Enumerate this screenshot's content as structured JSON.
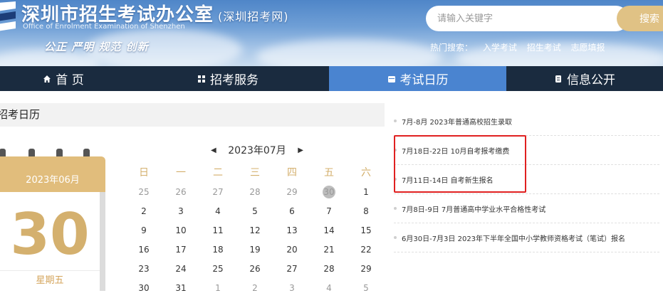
{
  "header": {
    "site_title": "深圳市招生考试办公室",
    "site_subtitle": "(深圳招考网)",
    "site_english": "Office of Enrolment Examination of Shenzhen",
    "slogan": "公正 严明 规范 创新",
    "search_placeholder": "请输入关键字",
    "search_button": "搜索",
    "hot_label": "热门搜索：",
    "hot_links": [
      "入学考试",
      "招生考试",
      "志愿填报"
    ]
  },
  "nav": {
    "items": [
      {
        "label": "首 页",
        "icon": "home-icon"
      },
      {
        "label": "招考服务",
        "icon": "grid-icon"
      },
      {
        "label": "考试日历",
        "icon": "calendar-icon",
        "active": true
      },
      {
        "label": "信息公开",
        "icon": "document-icon"
      }
    ]
  },
  "calendar_panel": {
    "title": "招考日历",
    "card": {
      "month": "2023年06月",
      "day": "30",
      "weekday": "星期五"
    },
    "month_label": "2023年07月",
    "weekdays": [
      "日",
      "一",
      "二",
      "三",
      "四",
      "五",
      "六"
    ],
    "rows": [
      [
        "25",
        "26",
        "27",
        "28",
        "29",
        "30",
        "1"
      ],
      [
        "2",
        "3",
        "4",
        "5",
        "6",
        "7",
        "8"
      ],
      [
        "9",
        "10",
        "11",
        "12",
        "13",
        "14",
        "15"
      ],
      [
        "16",
        "17",
        "18",
        "19",
        "20",
        "21",
        "22"
      ],
      [
        "23",
        "24",
        "25",
        "26",
        "27",
        "28",
        "29"
      ],
      [
        "30",
        "31",
        "1",
        "2",
        "3",
        "4",
        "5"
      ]
    ]
  },
  "news": {
    "items": [
      "7月-8月 2023年普通高校招生录取",
      "7月18日-22日 10月自考报考缴费",
      "7月11日-14日 自考新生报名",
      "7月8日-9日 7月普通高中学业水平合格性考试",
      "6月30日-7月3日 2023年下半年全国中小学教师资格考试（笔试）报名"
    ]
  },
  "colors": {
    "nav_bg": "#1a2b3f",
    "nav_active": "#4a84d0",
    "gold": "#e1bd7c",
    "highlight": "#e02020"
  }
}
